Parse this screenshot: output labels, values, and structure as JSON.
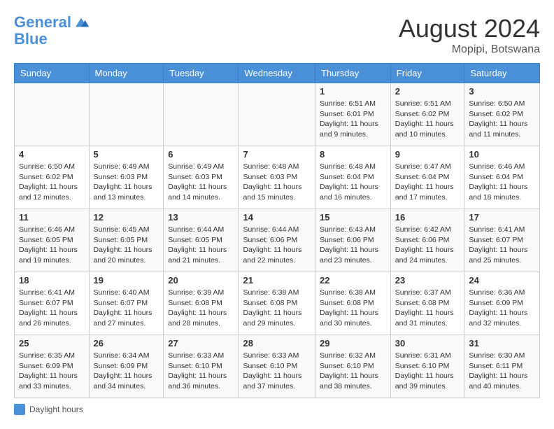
{
  "header": {
    "logo_line1": "General",
    "logo_line2": "Blue",
    "month_year": "August 2024",
    "location": "Mopipi, Botswana"
  },
  "weekdays": [
    "Sunday",
    "Monday",
    "Tuesday",
    "Wednesday",
    "Thursday",
    "Friday",
    "Saturday"
  ],
  "legend": {
    "label": "Daylight hours"
  },
  "weeks": [
    [
      {
        "day": "",
        "info": ""
      },
      {
        "day": "",
        "info": ""
      },
      {
        "day": "",
        "info": ""
      },
      {
        "day": "",
        "info": ""
      },
      {
        "day": "1",
        "info": "Sunrise: 6:51 AM\nSunset: 6:01 PM\nDaylight: 11 hours\nand 9 minutes."
      },
      {
        "day": "2",
        "info": "Sunrise: 6:51 AM\nSunset: 6:02 PM\nDaylight: 11 hours\nand 10 minutes."
      },
      {
        "day": "3",
        "info": "Sunrise: 6:50 AM\nSunset: 6:02 PM\nDaylight: 11 hours\nand 11 minutes."
      }
    ],
    [
      {
        "day": "4",
        "info": "Sunrise: 6:50 AM\nSunset: 6:02 PM\nDaylight: 11 hours\nand 12 minutes."
      },
      {
        "day": "5",
        "info": "Sunrise: 6:49 AM\nSunset: 6:03 PM\nDaylight: 11 hours\nand 13 minutes."
      },
      {
        "day": "6",
        "info": "Sunrise: 6:49 AM\nSunset: 6:03 PM\nDaylight: 11 hours\nand 14 minutes."
      },
      {
        "day": "7",
        "info": "Sunrise: 6:48 AM\nSunset: 6:03 PM\nDaylight: 11 hours\nand 15 minutes."
      },
      {
        "day": "8",
        "info": "Sunrise: 6:48 AM\nSunset: 6:04 PM\nDaylight: 11 hours\nand 16 minutes."
      },
      {
        "day": "9",
        "info": "Sunrise: 6:47 AM\nSunset: 6:04 PM\nDaylight: 11 hours\nand 17 minutes."
      },
      {
        "day": "10",
        "info": "Sunrise: 6:46 AM\nSunset: 6:04 PM\nDaylight: 11 hours\nand 18 minutes."
      }
    ],
    [
      {
        "day": "11",
        "info": "Sunrise: 6:46 AM\nSunset: 6:05 PM\nDaylight: 11 hours\nand 19 minutes."
      },
      {
        "day": "12",
        "info": "Sunrise: 6:45 AM\nSunset: 6:05 PM\nDaylight: 11 hours\nand 20 minutes."
      },
      {
        "day": "13",
        "info": "Sunrise: 6:44 AM\nSunset: 6:05 PM\nDaylight: 11 hours\nand 21 minutes."
      },
      {
        "day": "14",
        "info": "Sunrise: 6:44 AM\nSunset: 6:06 PM\nDaylight: 11 hours\nand 22 minutes."
      },
      {
        "day": "15",
        "info": "Sunrise: 6:43 AM\nSunset: 6:06 PM\nDaylight: 11 hours\nand 23 minutes."
      },
      {
        "day": "16",
        "info": "Sunrise: 6:42 AM\nSunset: 6:06 PM\nDaylight: 11 hours\nand 24 minutes."
      },
      {
        "day": "17",
        "info": "Sunrise: 6:41 AM\nSunset: 6:07 PM\nDaylight: 11 hours\nand 25 minutes."
      }
    ],
    [
      {
        "day": "18",
        "info": "Sunrise: 6:41 AM\nSunset: 6:07 PM\nDaylight: 11 hours\nand 26 minutes."
      },
      {
        "day": "19",
        "info": "Sunrise: 6:40 AM\nSunset: 6:07 PM\nDaylight: 11 hours\nand 27 minutes."
      },
      {
        "day": "20",
        "info": "Sunrise: 6:39 AM\nSunset: 6:08 PM\nDaylight: 11 hours\nand 28 minutes."
      },
      {
        "day": "21",
        "info": "Sunrise: 6:38 AM\nSunset: 6:08 PM\nDaylight: 11 hours\nand 29 minutes."
      },
      {
        "day": "22",
        "info": "Sunrise: 6:38 AM\nSunset: 6:08 PM\nDaylight: 11 hours\nand 30 minutes."
      },
      {
        "day": "23",
        "info": "Sunrise: 6:37 AM\nSunset: 6:08 PM\nDaylight: 11 hours\nand 31 minutes."
      },
      {
        "day": "24",
        "info": "Sunrise: 6:36 AM\nSunset: 6:09 PM\nDaylight: 11 hours\nand 32 minutes."
      }
    ],
    [
      {
        "day": "25",
        "info": "Sunrise: 6:35 AM\nSunset: 6:09 PM\nDaylight: 11 hours\nand 33 minutes."
      },
      {
        "day": "26",
        "info": "Sunrise: 6:34 AM\nSunset: 6:09 PM\nDaylight: 11 hours\nand 34 minutes."
      },
      {
        "day": "27",
        "info": "Sunrise: 6:33 AM\nSunset: 6:10 PM\nDaylight: 11 hours\nand 36 minutes."
      },
      {
        "day": "28",
        "info": "Sunrise: 6:33 AM\nSunset: 6:10 PM\nDaylight: 11 hours\nand 37 minutes."
      },
      {
        "day": "29",
        "info": "Sunrise: 6:32 AM\nSunset: 6:10 PM\nDaylight: 11 hours\nand 38 minutes."
      },
      {
        "day": "30",
        "info": "Sunrise: 6:31 AM\nSunset: 6:10 PM\nDaylight: 11 hours\nand 39 minutes."
      },
      {
        "day": "31",
        "info": "Sunrise: 6:30 AM\nSunset: 6:11 PM\nDaylight: 11 hours\nand 40 minutes."
      }
    ]
  ]
}
